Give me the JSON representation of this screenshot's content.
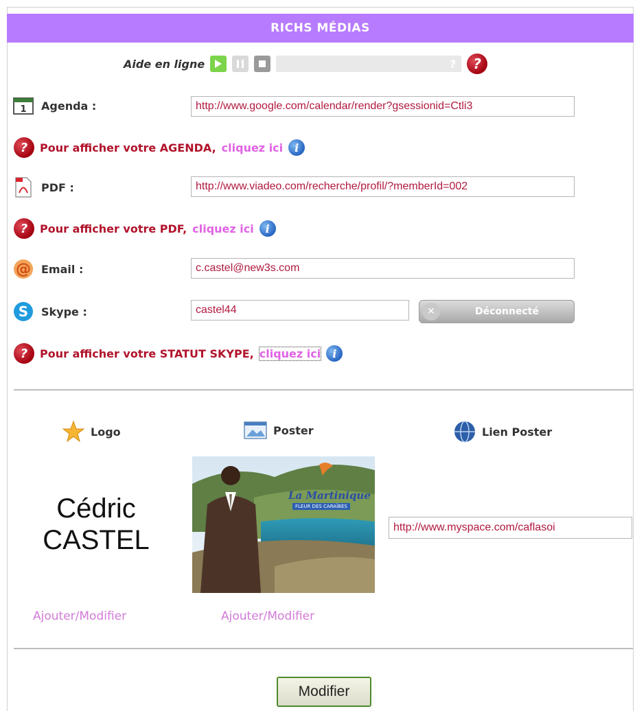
{
  "header": {
    "title": "RICHS MÉDIAS"
  },
  "aide": {
    "label": "Aide en ligne",
    "progress_hint": "?"
  },
  "agenda": {
    "label": "Agenda :",
    "value": "http://www.google.com/calendar/render?gsessionid=Ctli3",
    "help_text": "Pour afficher votre AGENDA,",
    "help_link": "cliquez ici"
  },
  "pdf": {
    "label": "PDF :",
    "value": "http://www.viadeo.com/recherche/profil/?memberId=002",
    "help_text": "Pour afficher votre PDF,",
    "help_link": "cliquez ici"
  },
  "email": {
    "label": "Email :",
    "value": "c.castel@new3s.com"
  },
  "skype": {
    "label": "Skype :",
    "value": "castel44",
    "status": "Déconnecté",
    "help_text": "Pour afficher votre STATUT SKYPE,",
    "help_link": "cliquez ici"
  },
  "media": {
    "logo_label": "Logo",
    "poster_label": "Poster",
    "lien_label": "Lien Poster",
    "logo_line1": "Cédric",
    "logo_line2": "CASTEL",
    "poster_brand": "La Martinique",
    "poster_tagline": "FLEUR DES CARAÏBES",
    "lien_value": "http://www.myspace.com/caflasoi",
    "add_logo": "Ajouter/Modifier",
    "add_poster": "Ajouter/Modifier"
  },
  "footer": {
    "submit_label": "Modifier"
  },
  "colors": {
    "header_bg": "#b77bff",
    "help_red": "#b1132b",
    "link_pink": "#e063e4",
    "input_text": "#b0193f"
  }
}
